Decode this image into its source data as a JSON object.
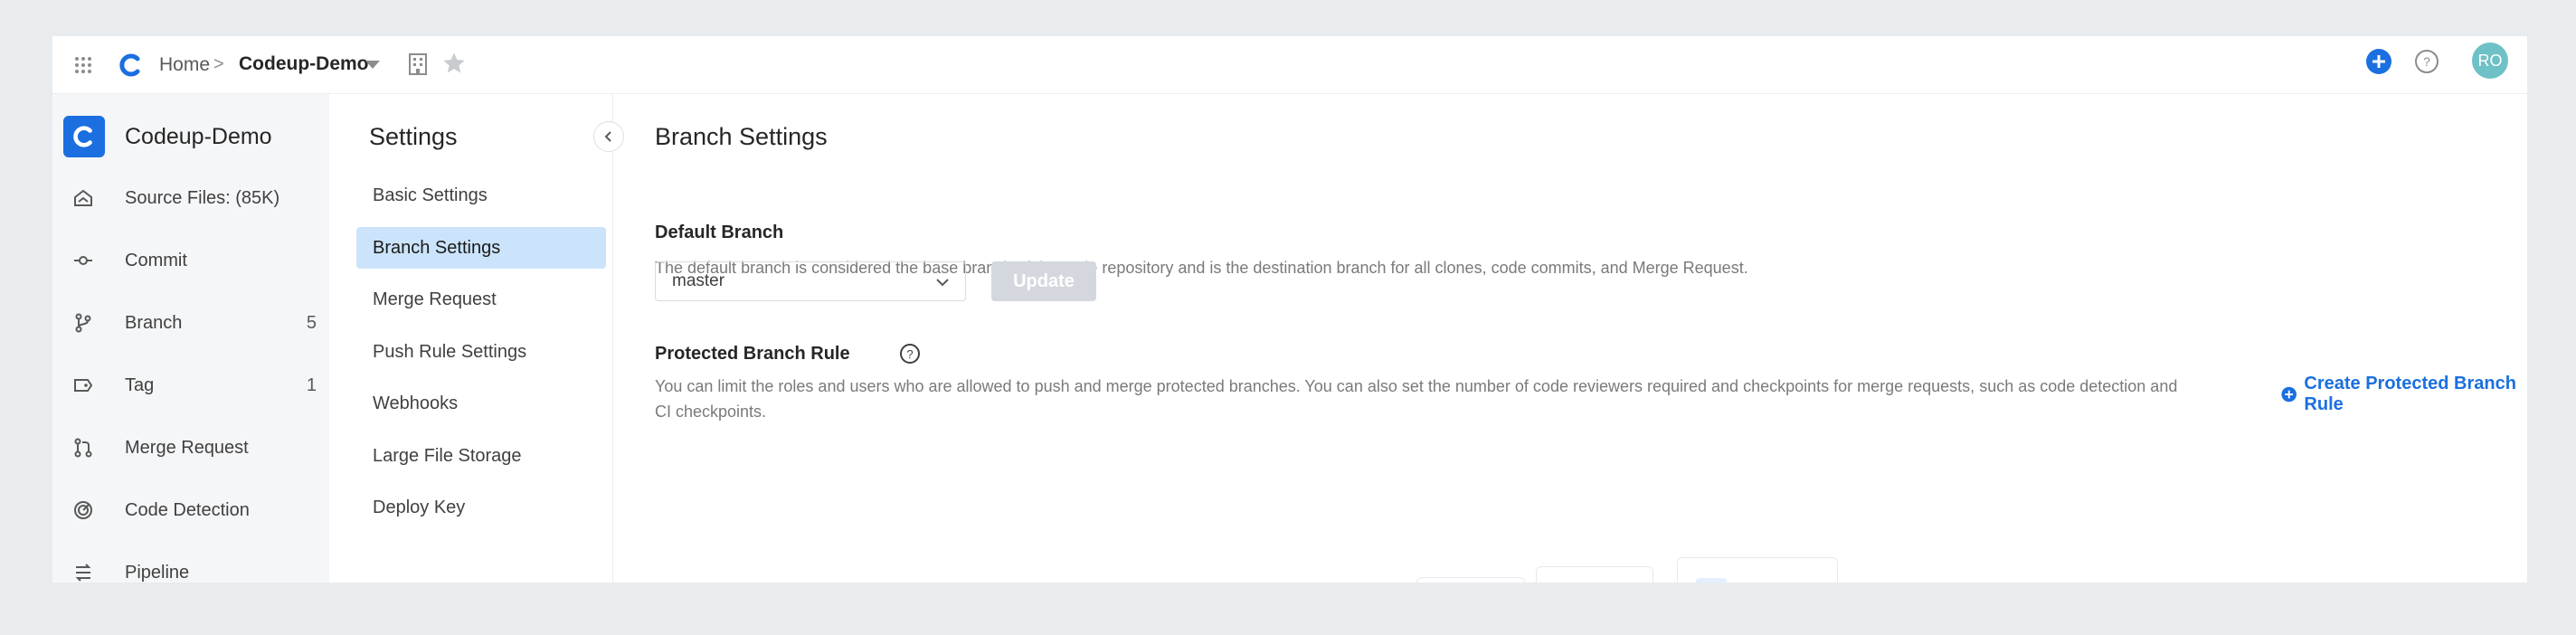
{
  "topbar": {
    "breadcrumb_home": "Home",
    "breadcrumb_sep": ">",
    "breadcrumb_repo": "Codeup-Demo",
    "avatar_initials": "RO",
    "accent": "#1b6fe0"
  },
  "repo": {
    "name": "Codeup-Demo"
  },
  "nav": {
    "items": [
      {
        "label": "Source Files: (85K)",
        "icon": "source-files-icon",
        "count": ""
      },
      {
        "label": "Commit",
        "icon": "commit-icon",
        "count": ""
      },
      {
        "label": "Branch",
        "icon": "branch-icon",
        "count": "5"
      },
      {
        "label": "Tag",
        "icon": "tag-icon",
        "count": "1"
      },
      {
        "label": "Merge Request",
        "icon": "merge-request-icon",
        "count": ""
      },
      {
        "label": "Code Detection",
        "icon": "code-detection-icon",
        "count": ""
      },
      {
        "label": "Pipeline",
        "icon": "pipeline-icon",
        "count": ""
      }
    ]
  },
  "settings": {
    "title": "Settings",
    "items": [
      {
        "label": "Basic Settings"
      },
      {
        "label": "Branch Settings"
      },
      {
        "label": "Merge Request"
      },
      {
        "label": "Push Rule Settings"
      },
      {
        "label": "Webhooks"
      },
      {
        "label": "Large File Storage"
      },
      {
        "label": "Deploy Key"
      }
    ],
    "active_index": 1
  },
  "main": {
    "title": "Branch Settings",
    "default_branch": {
      "title": "Default Branch",
      "description": "The default branch is considered the base branch of the code repository and is the destination branch for all clones, code commits, and Merge Request.",
      "selected": "master",
      "update_label": "Update"
    },
    "protected": {
      "title": "Protected Branch Rule",
      "description_line1": "You can limit the roles and users who are allowed to push and merge protected branches. You can also set the number of code reviewers required and checkpoints for merge requests, such as code detection and",
      "description_line2": "CI checkpoints.",
      "create_label": "Create Protected Branch Rule"
    }
  }
}
